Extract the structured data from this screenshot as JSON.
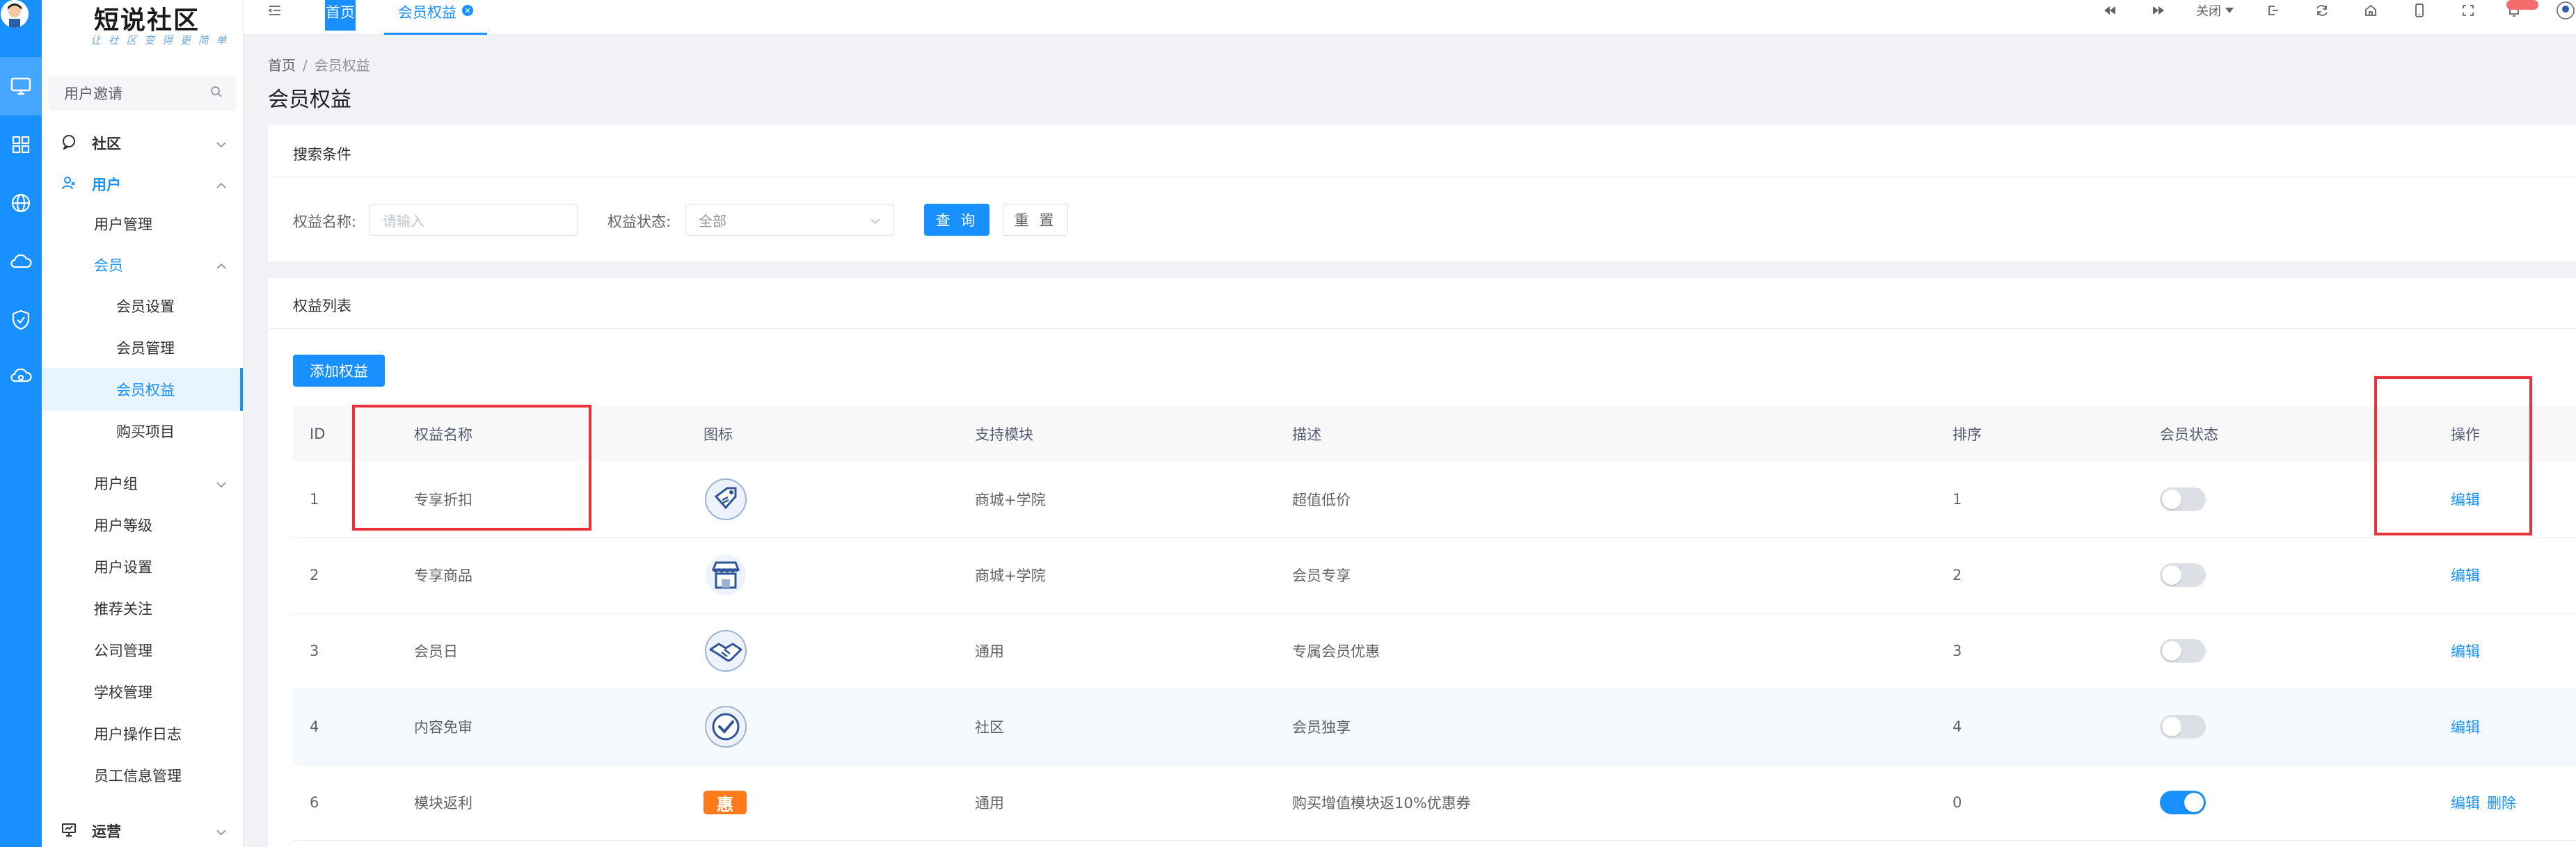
{
  "logo": {
    "title": "短说社区",
    "subtitle": "让 社 区 变 得 更 简 单"
  },
  "sidebar": {
    "search_placeholder": "用户邀请",
    "menu": [
      {
        "label": "社区"
      },
      {
        "label": "用户"
      },
      {
        "label": "用户管理"
      },
      {
        "label": "会员"
      },
      {
        "label": "会员设置"
      },
      {
        "label": "会员管理"
      },
      {
        "label": "会员权益"
      },
      {
        "label": "购买项目"
      },
      {
        "label": "用户组"
      },
      {
        "label": "用户等级"
      },
      {
        "label": "用户设置"
      },
      {
        "label": "推荐关注"
      },
      {
        "label": "公司管理"
      },
      {
        "label": "学校管理"
      },
      {
        "label": "用户操作日志"
      },
      {
        "label": "员工信息管理"
      },
      {
        "label": "运营"
      }
    ]
  },
  "header": {
    "tabs": [
      "首页",
      "会员权益"
    ],
    "close_label": "关闭"
  },
  "breadcrumb": {
    "home": "首页",
    "current": "会员权益",
    "sep": "/"
  },
  "page_title": "会员权益",
  "search_card": {
    "title": "搜索条件",
    "name_label": "权益名称:",
    "name_placeholder": "请输入",
    "status_label": "权益状态:",
    "status_value": "全部",
    "query_button": "查 询",
    "reset_button": "重 置"
  },
  "list_card": {
    "title": "权益列表",
    "add_button": "添加权益",
    "columns": [
      "ID",
      "权益名称",
      "图标",
      "支持模块",
      "描述",
      "排序",
      "会员状态",
      "操作"
    ],
    "rows": [
      {
        "id": "1",
        "name": "专享折扣",
        "icon": "discount-tag-icon",
        "module": "商城+学院",
        "desc": "超值低价",
        "sort": "1",
        "enabled": false,
        "actions": [
          "编辑"
        ]
      },
      {
        "id": "2",
        "name": "专享商品",
        "icon": "shop-icon",
        "module": "商城+学院",
        "desc": "会员专享",
        "sort": "2",
        "enabled": false,
        "actions": [
          "编辑"
        ]
      },
      {
        "id": "3",
        "name": "会员日",
        "icon": "handshake-icon",
        "module": "通用",
        "desc": "专属会员优惠",
        "sort": "3",
        "enabled": false,
        "actions": [
          "编辑"
        ]
      },
      {
        "id": "4",
        "name": "内容免审",
        "icon": "check-badge-icon",
        "module": "社区",
        "desc": "会员独享",
        "sort": "4",
        "enabled": false,
        "actions": [
          "编辑"
        ]
      },
      {
        "id": "6",
        "name": "模块返利",
        "icon": "hui-badge-icon",
        "icon_text": "惠",
        "module": "通用",
        "desc": "购买增值模块返10%优惠券",
        "sort": "0",
        "enabled": true,
        "actions": [
          "编辑",
          "删除"
        ]
      }
    ]
  },
  "colors": {
    "primary": "#1890ff",
    "highlight_box": "#e8313a",
    "badge": "#f56c6c",
    "hui": "#ff7a1a"
  }
}
